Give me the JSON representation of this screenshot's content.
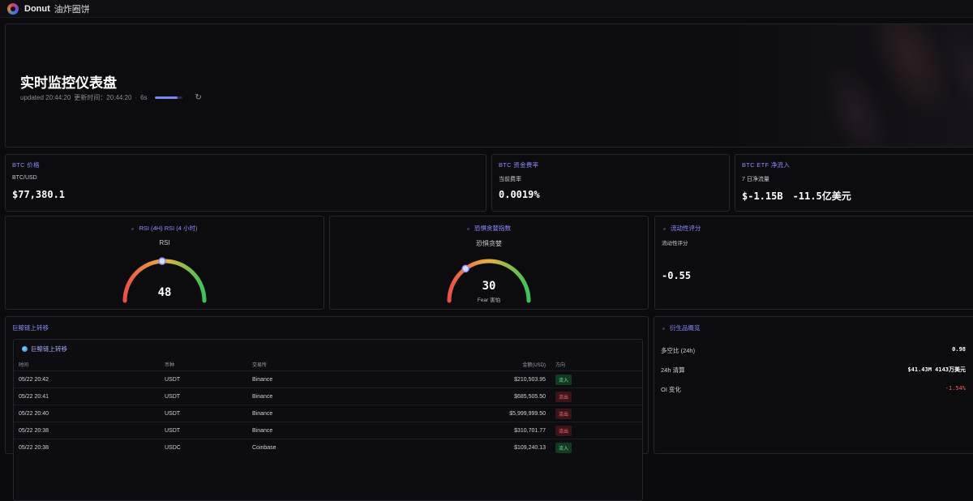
{
  "topbar": {
    "brand": "Donut",
    "brand_cn": "油炸圈饼"
  },
  "hero": {
    "title": "实时监控仪表盘",
    "updated_label": "updated 20:44:20",
    "updated_cn": "更新时间：20:44:20",
    "countdown": "6s",
    "countdown_progress": 0.85,
    "refresh_icon": "refresh-icon"
  },
  "btc_price": {
    "title": "BTC 价格",
    "pair": "BTC/USD",
    "value": "$77,380.1"
  },
  "funding": {
    "title": "BTC 资金费率",
    "sub": "当前费率",
    "value": "0.0019%"
  },
  "etf": {
    "title": "BTC ETF 净流入",
    "sub": "7 日净流量",
    "value_usd": "$-1.15B",
    "value_cn": "-11.5亿美元"
  },
  "rsi": {
    "title": "RSI (4H) RSI (4 小时)",
    "label": "RSI",
    "value": "48"
  },
  "fear_greed": {
    "title": "恐惧贪婪指数",
    "label": "恐惧贪婪",
    "value": "30",
    "caption": "Fear 害怕"
  },
  "liquidity": {
    "title": "流动性评分",
    "sub": "流动性评分",
    "value": "-0.55"
  },
  "whale": {
    "title": "巨鲸链上转移",
    "inner_title": "巨鲸链上转移",
    "columns": {
      "time": "时间",
      "coin": "币种",
      "exchange": "交易所",
      "amount": "金额(USD)",
      "direction": "方向"
    },
    "rows": [
      {
        "time": "05/22 20:42",
        "coin": "USDT",
        "exchange": "Binance",
        "amount": "$210,503.95",
        "direction": "流入",
        "type": "in"
      },
      {
        "time": "05/22 20:41",
        "coin": "USDT",
        "exchange": "Binance",
        "amount": "$685,505.50",
        "direction": "流出",
        "type": "out"
      },
      {
        "time": "05/22 20:40",
        "coin": "USDT",
        "exchange": "Binance",
        "amount": "$5,999,999.50",
        "direction": "流出",
        "type": "out"
      },
      {
        "time": "05/22 20:38",
        "coin": "USDT",
        "exchange": "Binance",
        "amount": "$310,701.77",
        "direction": "流出",
        "type": "out"
      },
      {
        "time": "05/22 20:38",
        "coin": "USDC",
        "exchange": "Coinbase",
        "amount": "$109,240.13",
        "direction": "流入",
        "type": "in"
      }
    ]
  },
  "derivatives": {
    "title": "衍生品概览",
    "long_short_label": "多空比 (24h)",
    "long_short_value": "0.98",
    "liq_label": "24h 清算",
    "liq_value": "$41.43M  4143万美元",
    "oi_label": "OI 变化",
    "oi_value": "-1.54%"
  },
  "colors": {
    "accent": "#8e8cff",
    "in": "#6be38e",
    "out": "#ff6b7a",
    "progress": "#7d86f0"
  }
}
